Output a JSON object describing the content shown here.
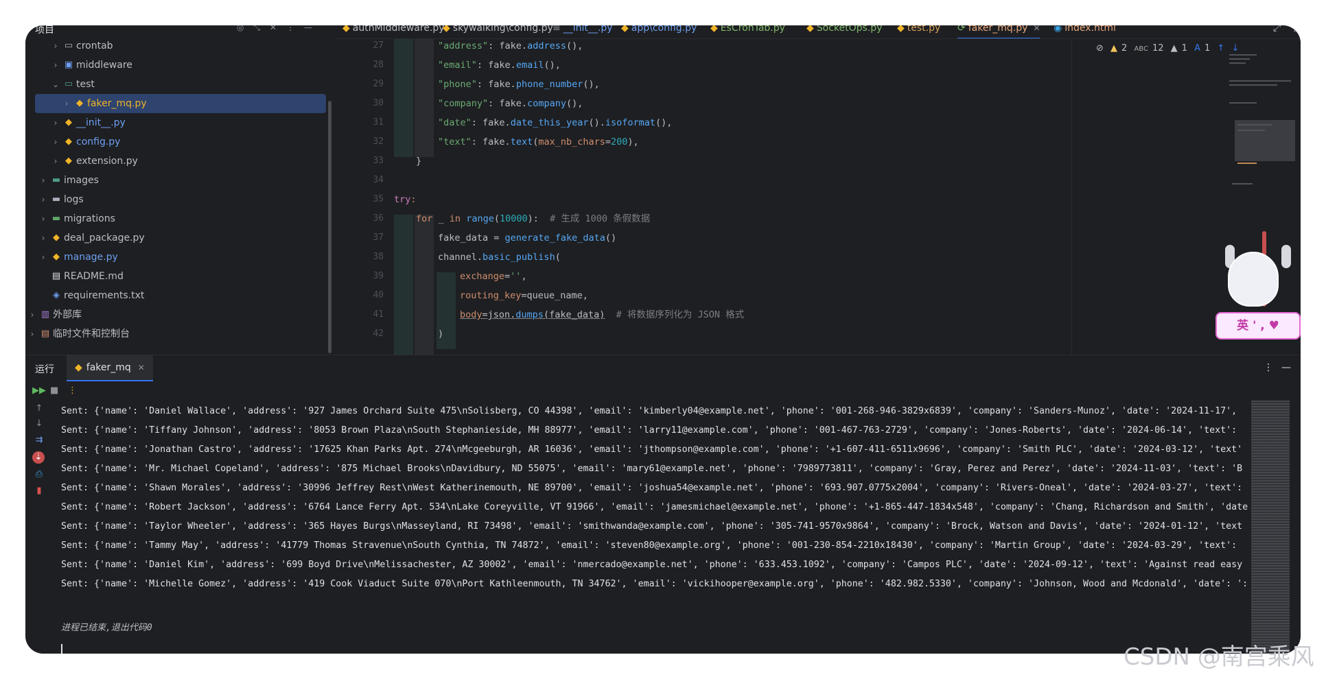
{
  "project_panel": {
    "title": "项目",
    "items": [
      {
        "label": "crontab",
        "icon": "folder-icon"
      },
      {
        "label": "middleware",
        "icon": "package-icon"
      },
      {
        "label": "test",
        "icon": "test-folder-icon"
      },
      {
        "label": "faker_mq.py",
        "icon": "python-file-icon"
      },
      {
        "label": "__init__.py",
        "icon": "python-file-icon"
      },
      {
        "label": "config.py",
        "icon": "python-file-icon"
      },
      {
        "label": "extension.py",
        "icon": "python-file-icon"
      },
      {
        "label": "images",
        "icon": "folder-icon"
      },
      {
        "label": "logs",
        "icon": "folder-icon"
      },
      {
        "label": "migrations",
        "icon": "folder-icon"
      },
      {
        "label": "deal_package.py",
        "icon": "python-file-icon"
      },
      {
        "label": "manage.py",
        "icon": "python-file-icon"
      },
      {
        "label": "README.md",
        "icon": "markdown-file-icon"
      },
      {
        "label": "requirements.txt",
        "icon": "text-file-icon"
      },
      {
        "label": "外部库",
        "icon": "library-icon"
      },
      {
        "label": "临时文件和控制台",
        "icon": "scratch-icon"
      }
    ]
  },
  "tabs": [
    {
      "label": "authMiddleware.py"
    },
    {
      "label": "skywalking\\config.py"
    },
    {
      "label": "__init__.py"
    },
    {
      "label": "app\\config.py"
    },
    {
      "label": "EsCronTab.py"
    },
    {
      "label": "SocketOps.py"
    },
    {
      "label": "test.py"
    },
    {
      "label": "faker_mq.py",
      "active": true
    },
    {
      "label": "index.html"
    }
  ],
  "inspections": {
    "warnings": "2",
    "typos": "12",
    "weak": "1",
    "info": "1"
  },
  "editor": {
    "line_numbers": [
      "27",
      "28",
      "29",
      "30",
      "31",
      "32",
      "33",
      "34",
      "35",
      "36",
      "37",
      "38",
      "39",
      "40",
      "41",
      "42"
    ],
    "lines": [
      "\"address\": fake.address(),",
      "\"email\": fake.email(),",
      "\"phone\": fake.phone_number(),",
      "\"company\": fake.company(),",
      "\"date\": fake.date_this_year().isoformat(),",
      "\"text\": fake.text(max_nb_chars=200),",
      "}",
      "",
      "try:",
      "for _ in range(10000):  # 生成 1000 条假数据",
      "fake_data = generate_fake_data()",
      "channel.basic_publish(",
      "exchange='',",
      "routing_key=queue_name,",
      "body=json.dumps(fake_data)  # 将数据序列化为 JSON 格式",
      ")"
    ]
  },
  "mascot_bubble": "英 ' , ♥",
  "run_panel": {
    "title": "运行",
    "tab_label": "faker_mq",
    "output": [
      "Sent: {'name': 'Daniel Wallace', 'address': '927 James Orchard Suite 475\\nSolisberg, CO 44398', 'email': 'kimberly04@example.net', 'phone': '001-268-946-3829x6839', 'company': 'Sanders-Munoz', 'date': '2024-11-17',",
      "Sent: {'name': 'Tiffany Johnson', 'address': '8053 Brown Plaza\\nSouth Stephanieside, MH 88977', 'email': 'larry11@example.com', 'phone': '001-467-763-2729', 'company': 'Jones-Roberts', 'date': '2024-06-14', 'text':",
      "Sent: {'name': 'Jonathan Castro', 'address': '17625 Khan Parks Apt. 274\\nMcgeeburgh, AR 16036', 'email': 'jthompson@example.com', 'phone': '+1-607-411-6511x9696', 'company': 'Smith PLC', 'date': '2024-03-12', 'text'",
      "Sent: {'name': 'Mr. Michael Copeland', 'address': '875 Michael Brooks\\nDavidbury, ND 55075', 'email': 'mary61@example.net', 'phone': '7989773811', 'company': 'Gray, Perez and Perez', 'date': '2024-11-03', 'text': 'B",
      "Sent: {'name': 'Shawn Morales', 'address': '30996 Jeffrey Rest\\nWest Katherinemouth, NE 89700', 'email': 'joshua54@example.net', 'phone': '693.907.0775x2004', 'company': 'Rivers-Oneal', 'date': '2024-03-27', 'text':",
      "Sent: {'name': 'Robert Jackson', 'address': '6764 Lance Ferry Apt. 534\\nLake Coreyville, VT 91966', 'email': 'jamesmichael@example.net', 'phone': '+1-865-447-1834x548', 'company': 'Chang, Richardson and Smith', 'date",
      "Sent: {'name': 'Taylor Wheeler', 'address': '365 Hayes Burgs\\nMasseyland, RI 73498', 'email': 'smithwanda@example.com', 'phone': '305-741-9570x9864', 'company': 'Brock, Watson and Davis', 'date': '2024-01-12', 'text",
      "Sent: {'name': 'Tammy May', 'address': '41779 Thomas Stravenue\\nSouth Cynthia, TN 74872', 'email': 'steven80@example.org', 'phone': '001-230-854-2210x18430', 'company': 'Martin Group', 'date': '2024-03-29', 'text':",
      "Sent: {'name': 'Daniel Kim', 'address': '699 Boyd Drive\\nMelissachester, AZ 30002', 'email': 'nmercado@example.net', 'phone': '633.453.1092', 'company': 'Campos PLC', 'date': '2024-09-12', 'text': 'Against read easy",
      "Sent: {'name': 'Michelle Gomez', 'address': '419 Cook Viaduct Suite 070\\nPort Kathleenmouth, TN 34762', 'email': 'vickihooper@example.org', 'phone': '482.982.5330', 'company': 'Johnson, Wood and Mcdonald', 'date': ':"
    ],
    "exit_message": "进程已结束,退出代码0"
  },
  "watermark": "CSDN @南宫乘风"
}
